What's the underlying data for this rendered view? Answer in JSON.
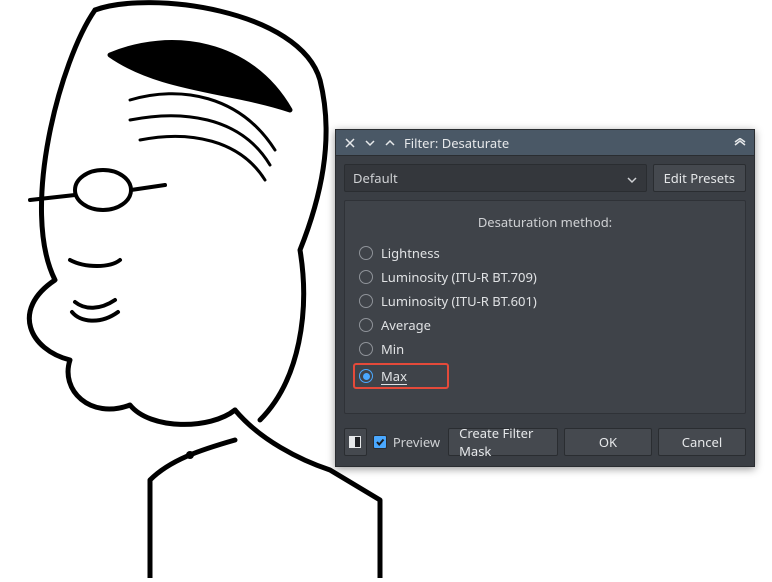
{
  "titlebar": {
    "title": "Filter: Desaturate"
  },
  "preset": {
    "selected": "Default",
    "edit_label": "Edit Presets"
  },
  "group": {
    "title": "Desaturation method:",
    "options": [
      {
        "label": "Lightness",
        "checked": false
      },
      {
        "label": "Luminosity (ITU-R BT.709)",
        "checked": false
      },
      {
        "label": "Luminosity (ITU-R BT.601)",
        "checked": false
      },
      {
        "label": "Average",
        "checked": false
      },
      {
        "label": "Min",
        "checked": false
      },
      {
        "label": "Max",
        "checked": true
      }
    ]
  },
  "footer": {
    "preview_label": "Preview",
    "preview_checked": true,
    "mask_label": "Create Filter Mask",
    "ok_label": "OK",
    "cancel_label": "Cancel"
  },
  "colors": {
    "accent": "#4aa8ff",
    "highlight": "#e44a3a",
    "panel": "#3a3e44",
    "titlebar": "#4a5866"
  }
}
